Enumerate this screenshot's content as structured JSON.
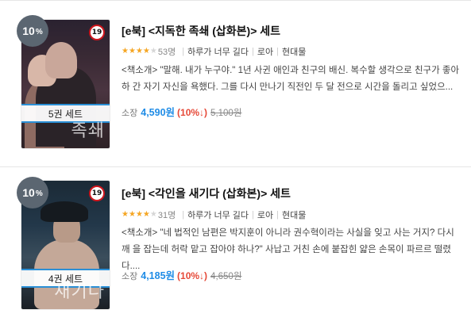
{
  "books": [
    {
      "discount_badge": "10",
      "discount_badge_unit": "%",
      "age_rating": "19",
      "cover_title_text": "족쇄",
      "set_label": "5권 세트",
      "title": "[e북] <지독한 족쇄 (삽화본)> 세트",
      "rating_stars": 4,
      "rating_count": "53명",
      "author": "하루가 너무 길다",
      "genre": "로아",
      "publisher": "현대물",
      "description": "<책소개> \"말해. 내가 누구야.\" 1년 사귄 애인과 친구의 배신. 복수할 생각으로 친구가 좋아하 간 자기 자신을 욕했다. 그를 다시 만나기 직전인 두 달 전으로 시간을 돌리고 싶었으...",
      "owned_label": "소장",
      "price": "4,590원",
      "discount_text": "(10%↓)",
      "original_price": "5,100원"
    },
    {
      "discount_badge": "10",
      "discount_badge_unit": "%",
      "age_rating": "19",
      "cover_title_text": "새기다",
      "set_label": "4권 세트",
      "title": "[e북] <각인을 새기다 (삽화본)> 세트",
      "rating_stars": 4,
      "rating_count": "31명",
      "author": "하루가 너무 길다",
      "genre": "로아",
      "publisher": "현대물",
      "description": "<책소개> \"네 법적인 남편은 박지훈이 아니라 권수혁이라는 사실을 잊고 사는 거지? 다시 깨 을 잡는데 허락 맡고 잡아야 하나?\" 사납고 거친 손에 붙잡힌 얇은 손목이 파르르 떨렸다....",
      "owned_label": "소장",
      "price": "4,185원",
      "discount_text": "(10%↓)",
      "original_price": "4,650원"
    }
  ],
  "colors": {
    "price": "#1f8ce6",
    "discount_text": "#e64938",
    "star_on": "#f5a623",
    "star_off": "#d6d6d6",
    "discount_badge_bg": "#5b6671",
    "set_line": "#2a8fd6"
  },
  "icons": [
    "star-icon",
    "age-19-badge-icon"
  ]
}
